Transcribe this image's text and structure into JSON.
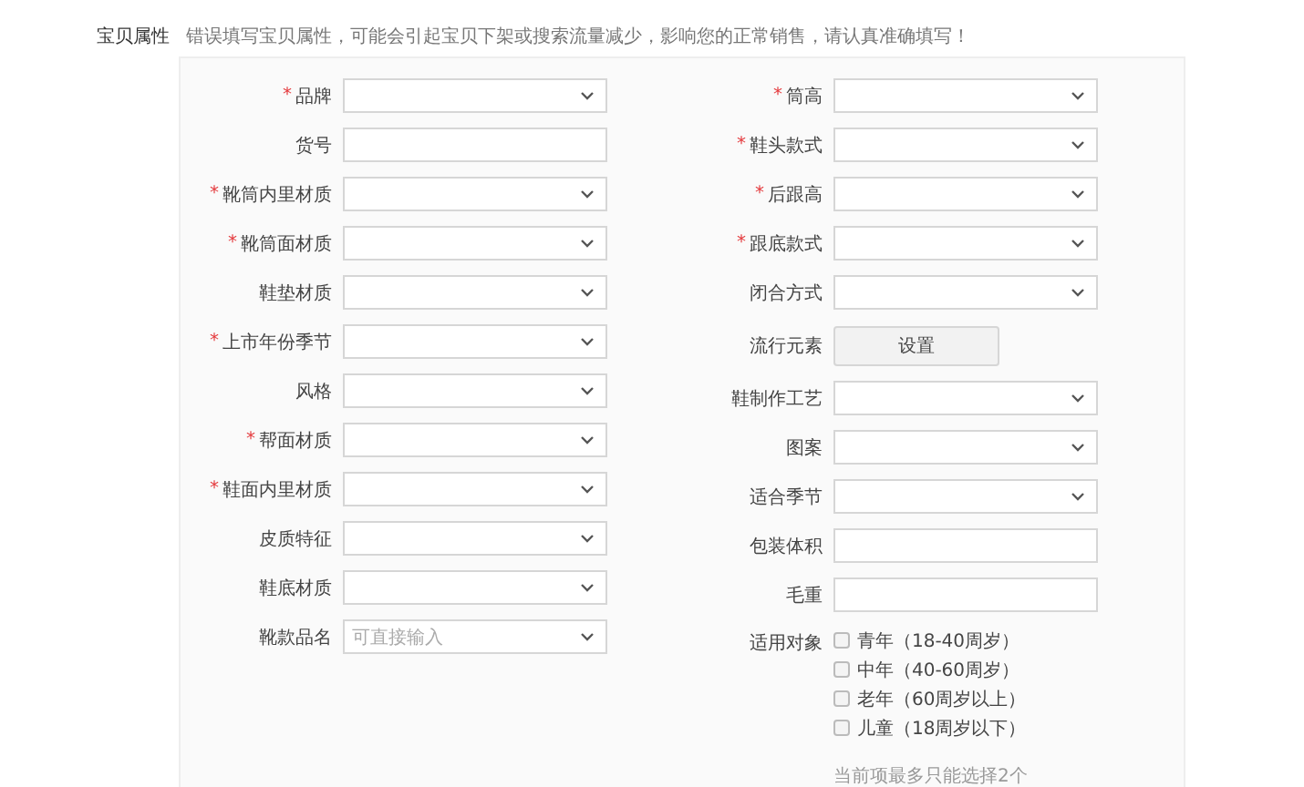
{
  "section": {
    "title": "宝贝属性",
    "note": "错误填写宝贝属性，可能会引起宝贝下架或搜索流量减少，影响您的正常销售，请认真准确填写！"
  },
  "left_fields": [
    {
      "label": "品牌",
      "required_mark": "*",
      "kind": "select"
    },
    {
      "label": "货号",
      "kind": "input"
    },
    {
      "label": "靴筒内里材质",
      "required_mark": "*",
      "kind": "select"
    },
    {
      "label": "靴筒面材质",
      "required_mark": "*",
      "kind": "select"
    },
    {
      "label": "鞋垫材质",
      "kind": "select"
    },
    {
      "label": "上市年份季节",
      "required_mark": "*",
      "kind": "select"
    },
    {
      "label": "风格",
      "kind": "select"
    },
    {
      "label": "帮面材质",
      "required_mark": "*",
      "kind": "select"
    },
    {
      "label": "鞋面内里材质",
      "required_mark": "*",
      "kind": "select"
    },
    {
      "label": "皮质特征",
      "kind": "select"
    },
    {
      "label": "鞋底材质",
      "kind": "select"
    },
    {
      "label": "靴款品名",
      "kind": "select",
      "placeholder": "可直接输入"
    }
  ],
  "right_fields": [
    {
      "label": "筒高",
      "required_mark": "*",
      "kind": "select"
    },
    {
      "label": "鞋头款式",
      "required_mark": "*",
      "kind": "select"
    },
    {
      "label": "后跟高",
      "required_mark": "*",
      "kind": "select"
    },
    {
      "label": "跟底款式",
      "required_mark": "*",
      "kind": "select"
    },
    {
      "label": "闭合方式",
      "kind": "select"
    },
    {
      "label": "流行元素",
      "kind": "button",
      "button": "设置"
    },
    {
      "label": "鞋制作工艺",
      "kind": "select"
    },
    {
      "label": "图案",
      "kind": "select"
    },
    {
      "label": "适合季节",
      "kind": "select"
    },
    {
      "label": "包装体积",
      "kind": "input"
    },
    {
      "label": "毛重",
      "kind": "input"
    },
    {
      "label": "适用对象",
      "kind": "checkboxes",
      "options": [
        {
          "label": "青年（18-40周岁）",
          "checked": false
        },
        {
          "label": "中年（40-60周岁）",
          "checked": false
        },
        {
          "label": "老年（60周岁以上）",
          "checked": false
        },
        {
          "label": "儿童（18周岁以下）",
          "checked": false
        }
      ],
      "hint": "当前项最多只能选择2个"
    }
  ]
}
